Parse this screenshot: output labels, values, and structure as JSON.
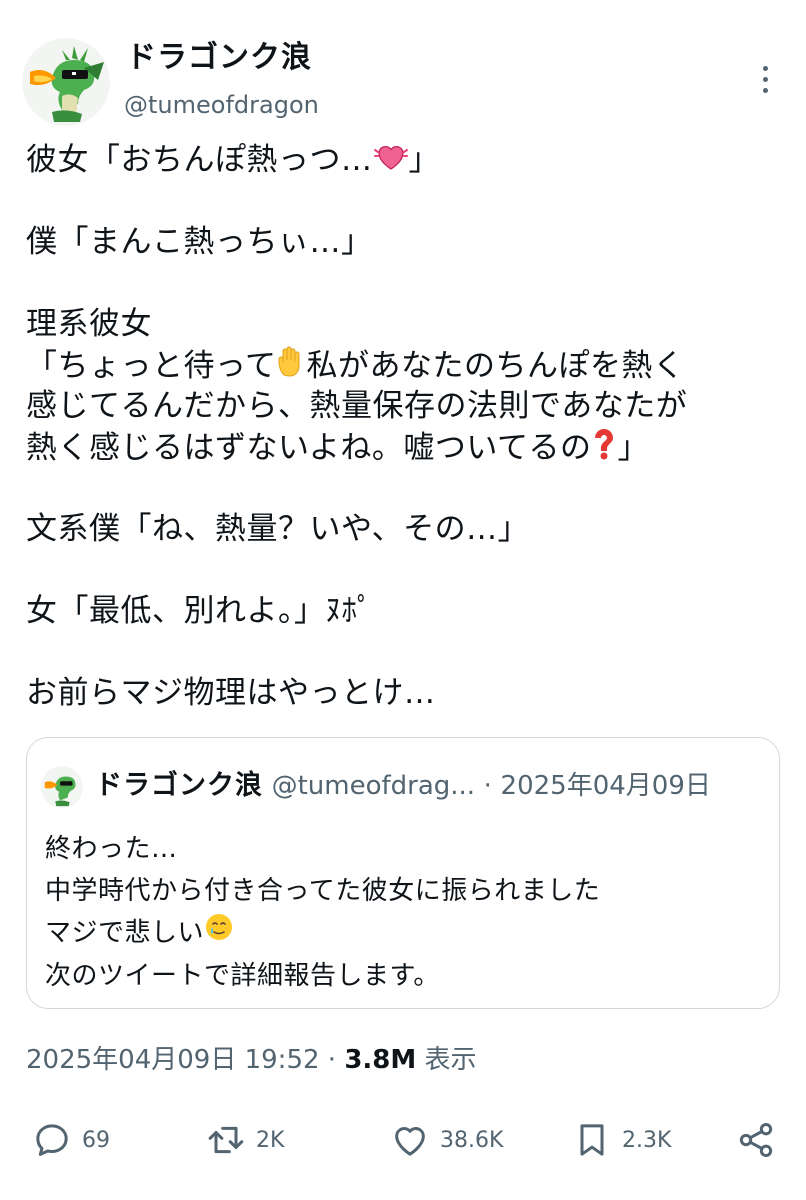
{
  "author": {
    "display_name": "ドラゴンク浪",
    "handle": "@tumeofdragon"
  },
  "tweet": {
    "lines": [
      {
        "pre": "彼女「おちんぽ熱っつ…",
        "emoji": "beating-heart-icon",
        "post": "」"
      },
      {
        "gap": true
      },
      {
        "pre": "僕「まんこ熱っちぃ…」"
      },
      {
        "gap": true
      },
      {
        "pre": "理系彼女"
      },
      {
        "pre": "「ちょっと待って",
        "emoji": "raised-hand-icon",
        "post": "私があなたのちんぽを熱く"
      },
      {
        "pre": "感じてるんだから、熱量保存の法則であなたが"
      },
      {
        "pre": "熱く感じるはずないよね。嘘ついてるの",
        "emoji": "red-question-icon",
        "post": "」"
      },
      {
        "gap": true
      },
      {
        "pre": "文系僕「ね、熱量？いや、その…」"
      },
      {
        "gap": true
      },
      {
        "pre": "女「最低、別れよ。」ﾇﾎﾟ"
      },
      {
        "gap": true
      },
      {
        "pre": "お前らマジ物理はやっとけ…"
      }
    ]
  },
  "quote": {
    "display_name": "ドラゴンク浪",
    "handle": "@tumeofdrag...",
    "separator": "·",
    "date": "2025年04月09日",
    "lines": [
      {
        "pre": "終わった…"
      },
      {
        "pre": "中学時代から付き合ってた彼女に振られました"
      },
      {
        "pre": "マジで悲しい",
        "emoji": "tearful-smile-icon"
      },
      {
        "pre": "次のツイートで詳細報告します。"
      }
    ]
  },
  "meta": {
    "datetime": "2025年04月09日 19:52",
    "separator": "·",
    "views_count": "3.8M",
    "views_label": "表示"
  },
  "actions": {
    "replies": "69",
    "reposts": "2K",
    "likes": "38.6K",
    "bookmarks": "2.3K"
  },
  "colors": {
    "text": "#0f1419",
    "secondary": "#536471",
    "border": "#cfd9de"
  }
}
